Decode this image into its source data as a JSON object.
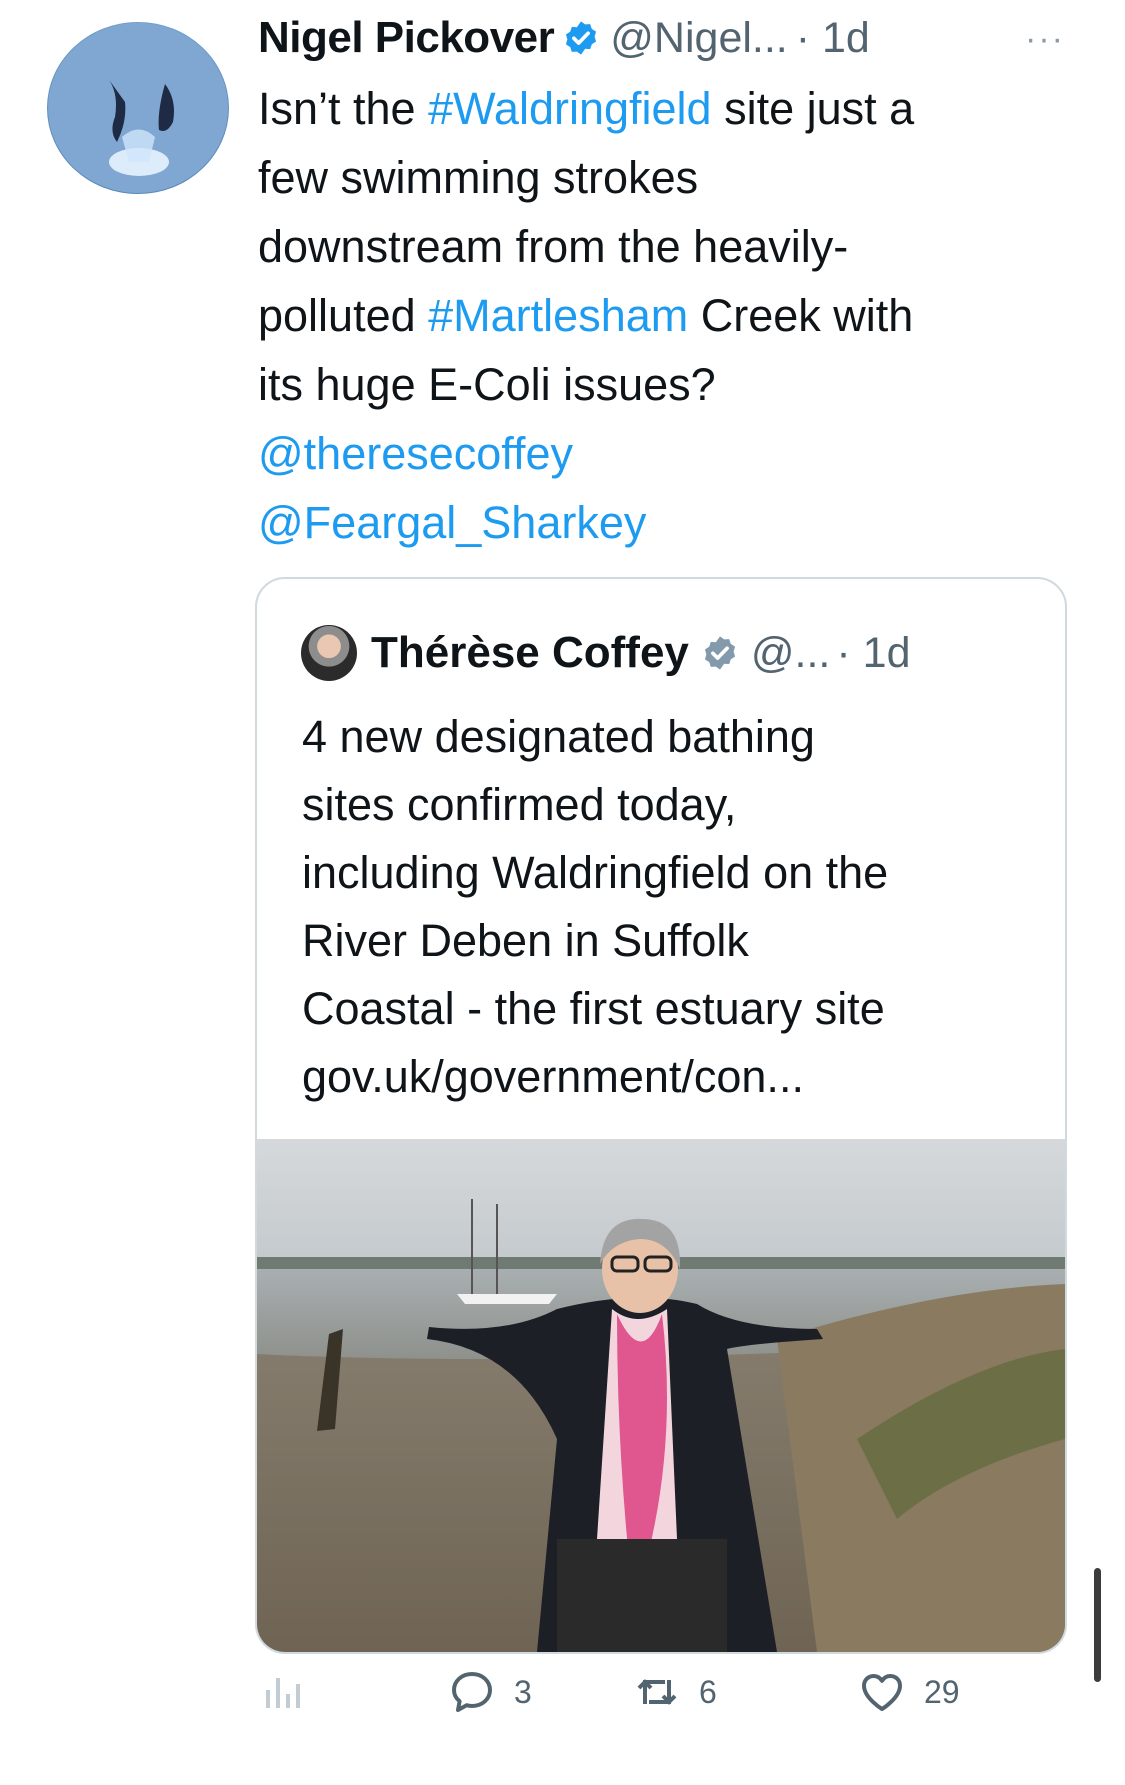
{
  "tweet": {
    "author_name": "Nigel Pickover",
    "author_handle": "@Nigel...",
    "time": "· 1d",
    "more_label": "···",
    "lines": [
      [
        {
          "t": "Isn’t the "
        },
        {
          "t": "#Waldringfield",
          "link": true
        },
        {
          "t": " site just a"
        }
      ],
      [
        {
          "t": "few swimming strokes"
        }
      ],
      [
        {
          "t": "downstream from the heavily-"
        }
      ],
      [
        {
          "t": "polluted "
        },
        {
          "t": "#Martlesham",
          "link": true
        },
        {
          "t": " Creek with"
        }
      ],
      [
        {
          "t": "its huge E-Coli issues?"
        }
      ],
      [
        {
          "t": "@theresecoffey",
          "link": true
        }
      ],
      [
        {
          "t": "@Feargal_Sharkey",
          "link": true
        }
      ]
    ]
  },
  "quote": {
    "author_name": "Thérèse Coffey",
    "author_handle": "@...",
    "time": "· 1d",
    "lines": [
      "4 new designated bathing",
      "sites confirmed today,",
      "including Waldringfield on the",
      "River Deben in Suffolk",
      "Coastal - the first estuary site",
      "gov.uk/government/con..."
    ]
  },
  "actions": {
    "analytics_icon": "bar-chart-icon",
    "reply_count": "3",
    "retweet_count": "6",
    "like_count": "29"
  },
  "colors": {
    "link": "#1d9bf0",
    "verified": "#1d9bf0",
    "secondary_text": "#536471",
    "border": "#cfd9de"
  }
}
